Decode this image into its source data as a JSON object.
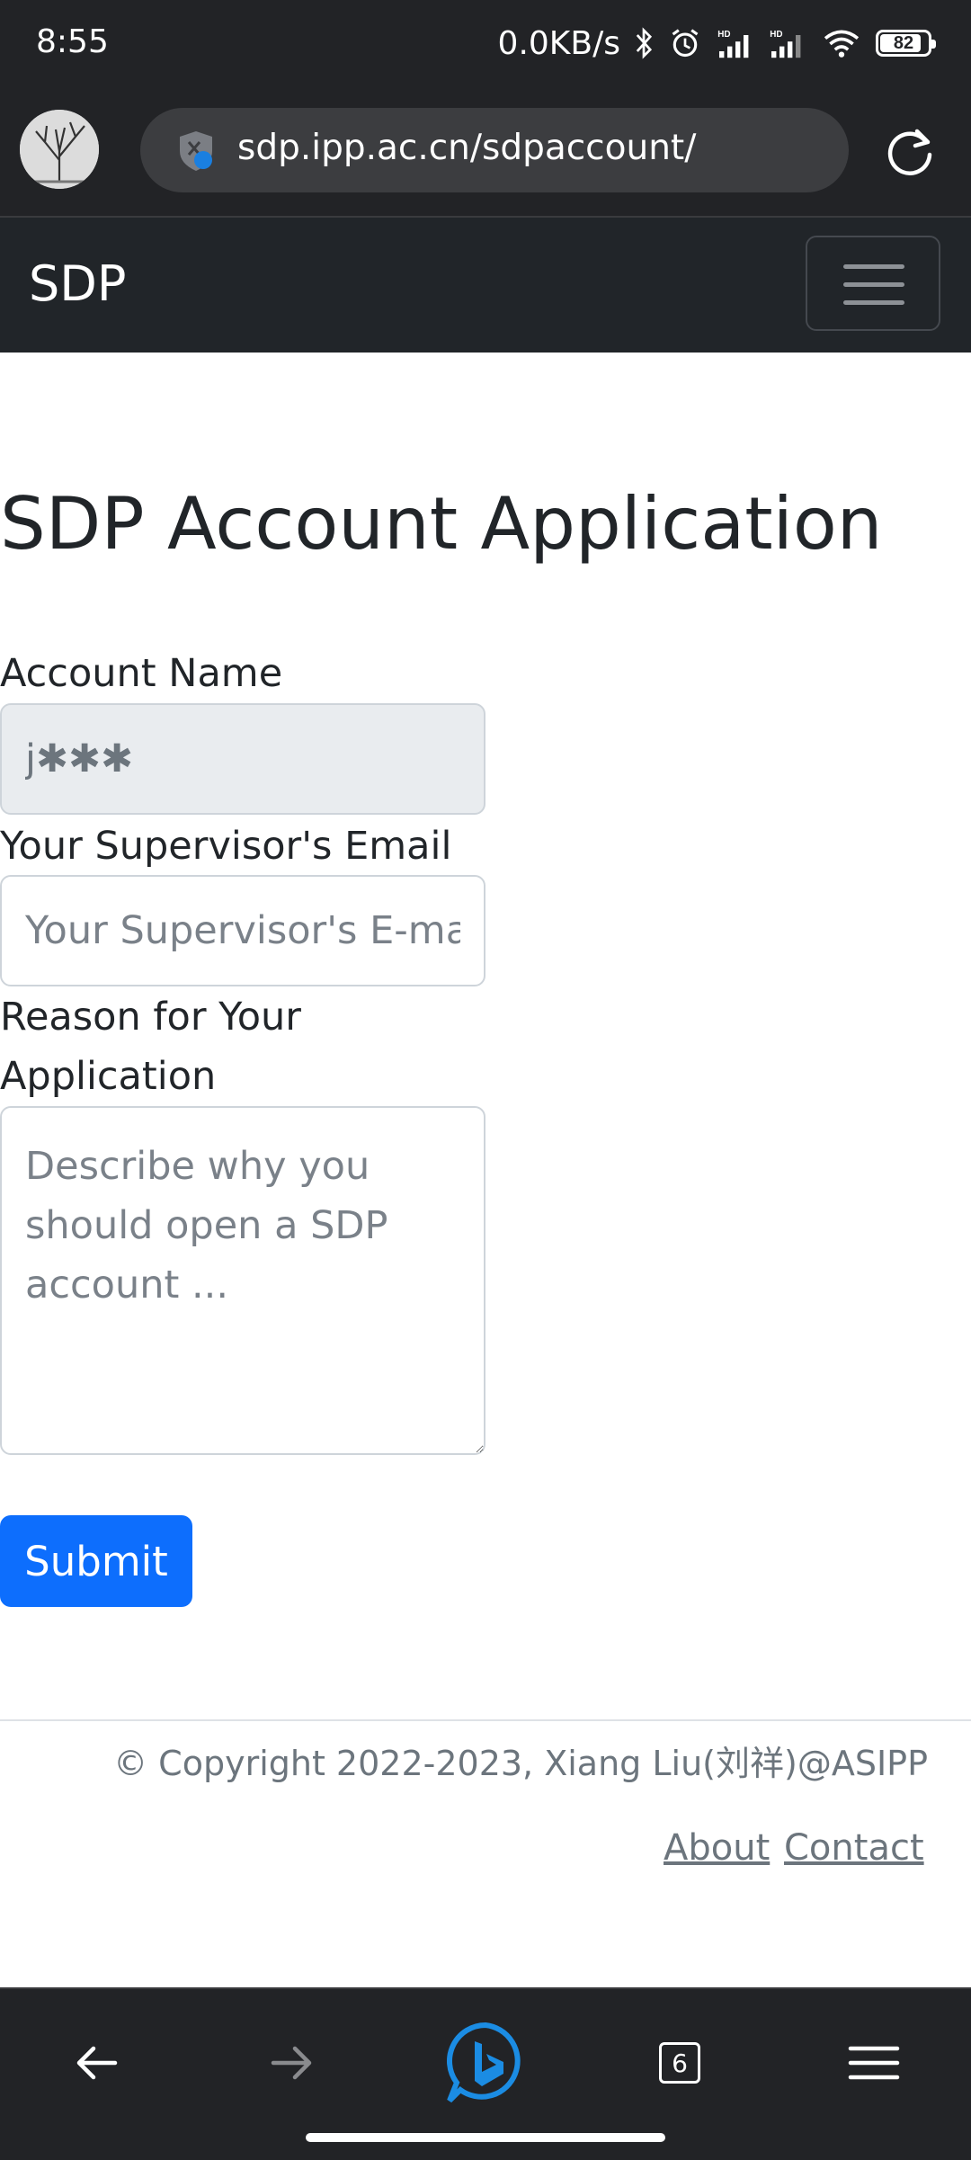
{
  "status_bar": {
    "time": "8:55",
    "net_speed": "0.0KB/s",
    "battery": "82",
    "icons": [
      "bluetooth-icon",
      "alarm-icon",
      "signal-hd-icon",
      "signal-hd-icon",
      "wifi-icon",
      "battery-icon"
    ]
  },
  "browser": {
    "url": "sdp.ipp.ac.cn/sdpaccount/"
  },
  "navbar": {
    "brand": "SDP"
  },
  "form": {
    "title": "SDP Account Application",
    "account_label": "Account Name",
    "account_value": "j✱✱✱",
    "supervisor_label": "Your Supervisor's Email",
    "supervisor_placeholder": "Your Supervisor's E-mail",
    "reason_label": "Reason for Your Application",
    "reason_placeholder": "Describe why you should open a SDP account ...",
    "submit_label": "Submit"
  },
  "footer": {
    "copyright": "© Copyright 2022-2023, Xiang Liu(刘祥)@ASIPP",
    "links": [
      "About",
      "Contact"
    ]
  },
  "bottom_nav": {
    "tabs_count": "6",
    "colors": {
      "accent": "#0d6efd",
      "bing": "#1b8ce3"
    }
  }
}
